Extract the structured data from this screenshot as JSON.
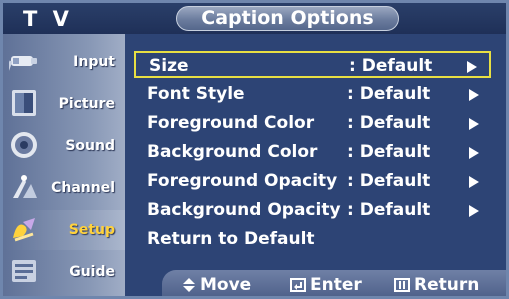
{
  "header": {
    "app_label": "T V",
    "menu_title": "Caption Options"
  },
  "sidebar": {
    "items": [
      {
        "label": "Input",
        "icon": "input-icon"
      },
      {
        "label": "Picture",
        "icon": "picture-icon"
      },
      {
        "label": "Sound",
        "icon": "sound-icon"
      },
      {
        "label": "Channel",
        "icon": "channel-icon"
      },
      {
        "label": "Setup",
        "icon": "setup-icon",
        "active": true
      },
      {
        "label": "Guide",
        "icon": "guide-icon"
      }
    ]
  },
  "menu": {
    "rows": [
      {
        "label": "Size",
        "value": ": Default",
        "selected": true,
        "has_arrow": true
      },
      {
        "label": "Font Style",
        "value": ": Default",
        "has_arrow": true
      },
      {
        "label": "Foreground Color",
        "value": ": Default",
        "has_arrow": true
      },
      {
        "label": "Background Color",
        "value": ": Default",
        "has_arrow": true
      },
      {
        "label": "Foreground Opacity",
        "value": ": Default",
        "has_arrow": true
      },
      {
        "label": "Background Opacity",
        "value": ": Default",
        "has_arrow": true
      },
      {
        "label": "Return to Default",
        "value": "",
        "has_arrow": false
      }
    ]
  },
  "footer": {
    "move_label": "Move",
    "enter_label": "Enter",
    "return_label": "Return"
  },
  "colors": {
    "highlight": "#e8df43",
    "active_label": "#ffd23c",
    "panel": "#2d4475"
  }
}
